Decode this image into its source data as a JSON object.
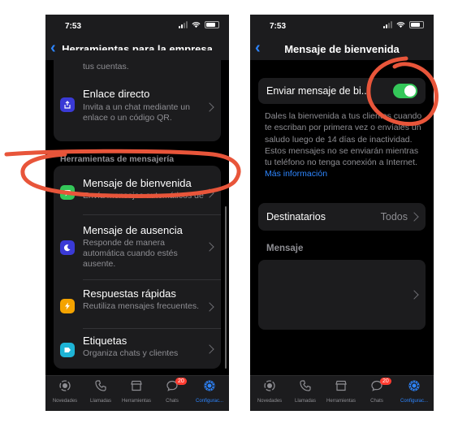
{
  "left": {
    "status_time": "7:53",
    "nav_title": "Herramientas para la empresa",
    "top_partial": "tus cuentas.",
    "direct_link": {
      "title": "Enlace directo",
      "subtitle": "Invita a un chat mediante un enlace o un código QR."
    },
    "section_header": "Herramientas de mensajería",
    "items": [
      {
        "title": "Mensaje de bienvenida",
        "subtitle": "Envía mensajes automáticos de bienvenida."
      },
      {
        "title": "Mensaje de ausencia",
        "subtitle": "Responde de manera automática cuando estés ausente."
      },
      {
        "title": "Respuestas rápidas",
        "subtitle": "Reutiliza mensajes frecuentes."
      },
      {
        "title": "Etiquetas",
        "subtitle": "Organiza chats y clientes"
      }
    ]
  },
  "right": {
    "status_time": "7:53",
    "nav_title": "Mensaje de bienvenida",
    "toggle_label": "Enviar mensaje de bi...",
    "toggle_on": true,
    "description": "Dales la bienvenida a tus clientes cuando te escriban por primera vez o envíales un saludo luego de 14 días de inactividad. Estos mensajes no se enviarán mientras tu teléfono no tenga conexión a Internet.",
    "more_info": "Más información",
    "recipients_label": "Destinatarios",
    "recipients_value": "Todos",
    "message_header": "Mensaje"
  },
  "tabs": [
    {
      "label": "Novedades",
      "icon": "status-ring-icon"
    },
    {
      "label": "Llamadas",
      "icon": "phone-icon"
    },
    {
      "label": "Herramientas",
      "icon": "store-icon"
    },
    {
      "label": "Chats",
      "icon": "chat-bubble-icon",
      "badge": "20"
    },
    {
      "label": "Configurac...",
      "icon": "gear-icon",
      "active": true
    }
  ],
  "colors": {
    "accent": "#2e86ff",
    "toggle_on": "#34c759",
    "annotation": "#e8553a",
    "badge": "#ff3b30"
  }
}
